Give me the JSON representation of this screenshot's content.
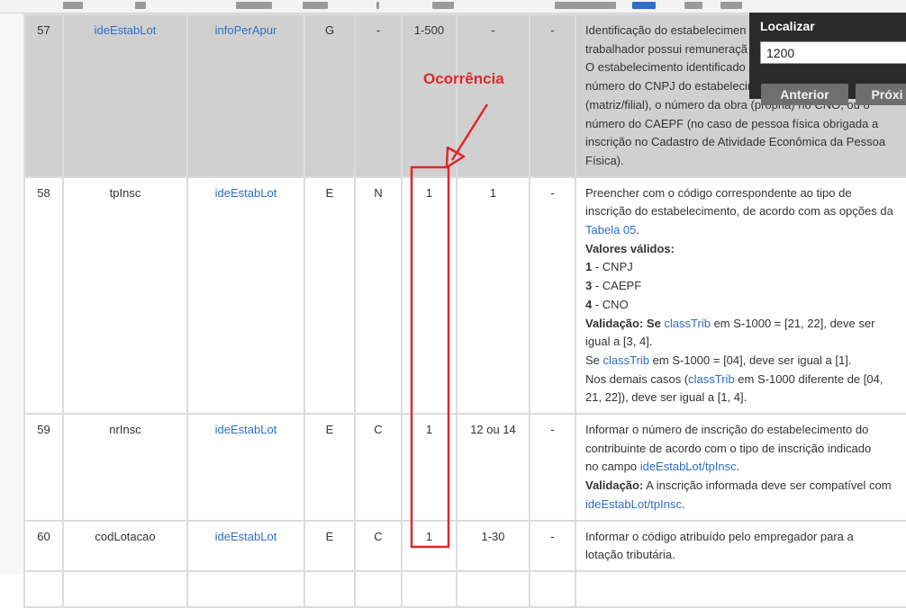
{
  "find": {
    "title": "Localizar",
    "query": "1200",
    "prev_label": "Anterior",
    "next_label": "Próxi"
  },
  "annotation": {
    "label": "Ocorrência",
    "color": "#e3262b"
  },
  "rows": [
    {
      "seq": "57",
      "name": "ideEstabLot",
      "parent": "infoPerApur",
      "elem": "G",
      "tipo": "-",
      "ocorr": "1-500",
      "tam": "-",
      "dec": "-",
      "desc": {
        "l1": "Identificação do estabelecimen",
        "l2": "trabalhador possui remuneraçã",
        "l3": "O estabelecimento identificado",
        "l4": "número do CNPJ do estabelecin",
        "l5": "(matriz/filial), o número da obra (própria) no CNO, ou o",
        "l6": "número do CAEPF (no caso de pessoa física obrigada a",
        "l7": "inscrição no Cadastro de Atividade Econômica da Pessoa",
        "l8": "Física)."
      }
    },
    {
      "seq": "58",
      "name": "tpInsc",
      "parent": "ideEstabLot",
      "elem": "E",
      "tipo": "N",
      "ocorr": "1",
      "tam": "1",
      "dec": "-",
      "desc": {
        "l1": "Preencher com o código correspondente ao tipo de",
        "l2": "inscrição do estabelecimento, de acordo com as opções da",
        "tabela": "Tabela 05",
        "tabela_end": ".",
        "valores": "Valores válidos:",
        "v1_code": "1",
        "v1_text": " - CNPJ",
        "v3_code": "3",
        "v3_text": " - CAEPF",
        "v4_code": "4",
        "v4_text": " - CNO",
        "val_label": "Validação:",
        "val_a": " Se ",
        "val_link": "classTrib",
        "val_b": " em S-1000 = [21, 22], deve ser",
        "val_c": "igual a [3, 4].",
        "se2_a": "Se ",
        "se2_link": "classTrib",
        "se2_b": " em S-1000 = [04], deve ser igual a [1].",
        "dem_a": "Nos demais casos (",
        "dem_link": "classTrib",
        "dem_b": " em S-1000 diferente de [04,",
        "dem_c": "21, 22]), deve ser igual a [1, 4]."
      }
    },
    {
      "seq": "59",
      "name": "nrInsc",
      "parent": "ideEstabLot",
      "elem": "E",
      "tipo": "C",
      "ocorr": "1",
      "tam": "12 ou 14",
      "dec": "-",
      "desc": {
        "l1": "Informar o número de inscrição do estabelecimento do",
        "l2": "contribuinte de acordo com o tipo de inscrição indicado",
        "l3a": "no campo ",
        "l3_link": "ideEstabLot/tpInsc",
        "l3b": ".",
        "val_label": "Validação:",
        "val_text": " A inscrição informada deve ser compatível com",
        "l5_link": "ideEstabLot/tpInsc",
        "l5b": "."
      }
    },
    {
      "seq": "60",
      "name": "codLotacao",
      "parent": "ideEstabLot",
      "elem": "E",
      "tipo": "C",
      "ocorr": "1",
      "tam": "1-30",
      "dec": "-",
      "desc": {
        "l1": "Informar o código atribuído pelo empregador para a",
        "l2": "lotação tributária."
      }
    }
  ]
}
